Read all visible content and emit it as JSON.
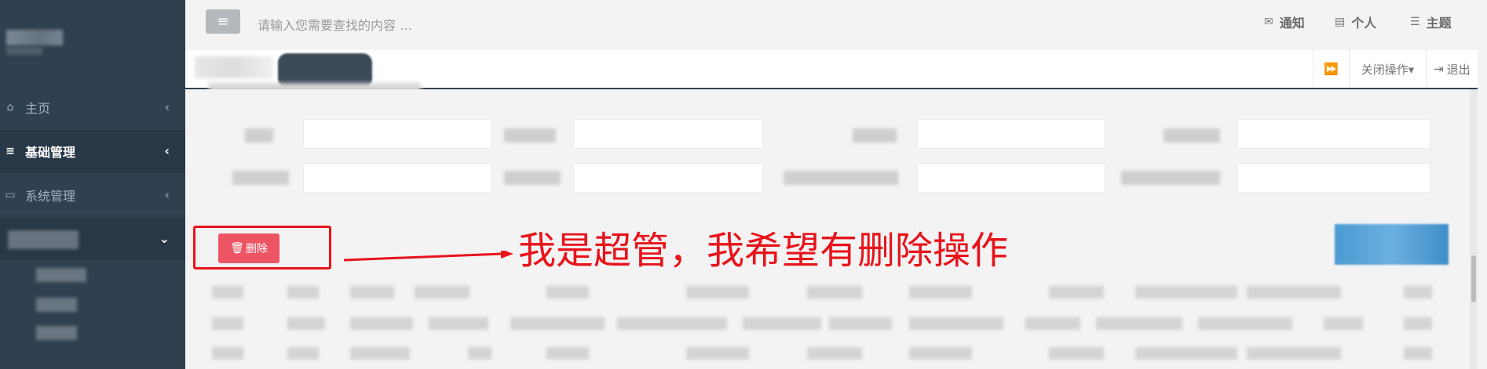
{
  "sidebar": {
    "items": [
      {
        "label": "主页",
        "icon": "home-icon",
        "arrow": "‹"
      },
      {
        "label": "基础管理",
        "icon": "list-icon",
        "arrow": "‹"
      },
      {
        "label": "系统管理",
        "icon": "monitor-icon",
        "arrow": "‹"
      },
      {
        "label": "",
        "icon": "",
        "arrow": "⌄"
      }
    ]
  },
  "topbar": {
    "menu_icon": "≡",
    "search_placeholder": "请输入您需要查找的内容 …",
    "notify_label": "通知",
    "profile_label": "个人",
    "theme_label": "主题"
  },
  "tabbar": {
    "forward_icon": "⏩",
    "close_ops_label": "关闭操作▾",
    "logout_label": "退出"
  },
  "content": {
    "delete_button_label": "删除",
    "annotation_text": "我是超管，我希望有删除操作"
  },
  "colors": {
    "sidebar_bg": "#2f4050",
    "danger": "#ed5565",
    "annotation": "#e8131a",
    "primary": "#4a9ad2"
  }
}
